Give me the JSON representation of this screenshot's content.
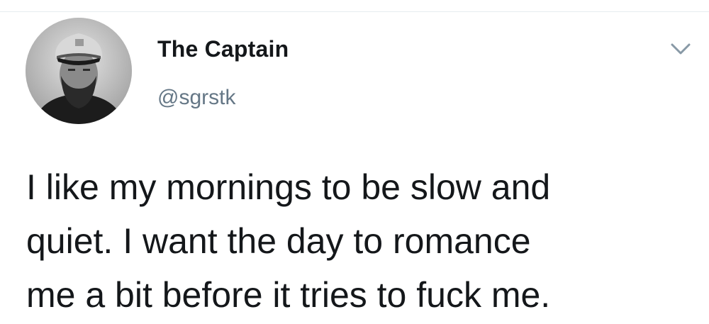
{
  "author": {
    "name": "The Captain",
    "handle": "@sgrstk",
    "avatar_icon": "avatar-photo-captain-hat"
  },
  "menu": {
    "icon": "chevron-down-icon",
    "color": "#8899a6"
  },
  "tweet": {
    "text": "I like my mornings to be slow and\nquiet. I want the day to romance\nme a bit before it tries to fuck me."
  },
  "colors": {
    "text": "#14171a",
    "secondary": "#657786",
    "divider": "#e6ecf0",
    "background": "#ffffff"
  }
}
